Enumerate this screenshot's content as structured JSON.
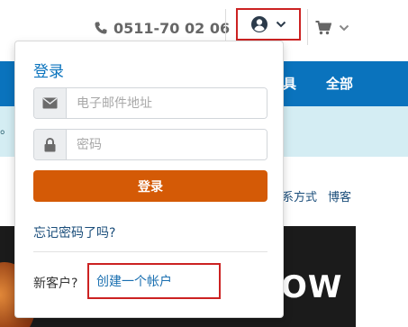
{
  "header": {
    "phone_icon": "phone-icon",
    "phone_number": "0511-70 02 06",
    "account_icon": "user-circle-icon",
    "cart_icon": "cart-icon"
  },
  "nav": {
    "partial_item": "具",
    "item_all": "全部"
  },
  "alert": {
    "partial_text": "。"
  },
  "page_links": {
    "contact_partial": "系方式",
    "blog": "博客"
  },
  "hero": {
    "partial_text": "OW"
  },
  "login_dropdown": {
    "title": "登录",
    "email": {
      "placeholder": "电子邮件地址",
      "icon": "envelope-icon"
    },
    "password": {
      "placeholder": "密码",
      "icon": "lock-icon"
    },
    "submit_label": "登录",
    "forgot_password": "忘记密码了吗?",
    "new_customer_label": "新客户?",
    "create_account": "创建一个帐户"
  },
  "colors": {
    "nav_blue": "#0a73bd",
    "button_orange": "#d45a06",
    "highlight_red": "#cc2222",
    "alert_bg": "#d4edf3"
  }
}
